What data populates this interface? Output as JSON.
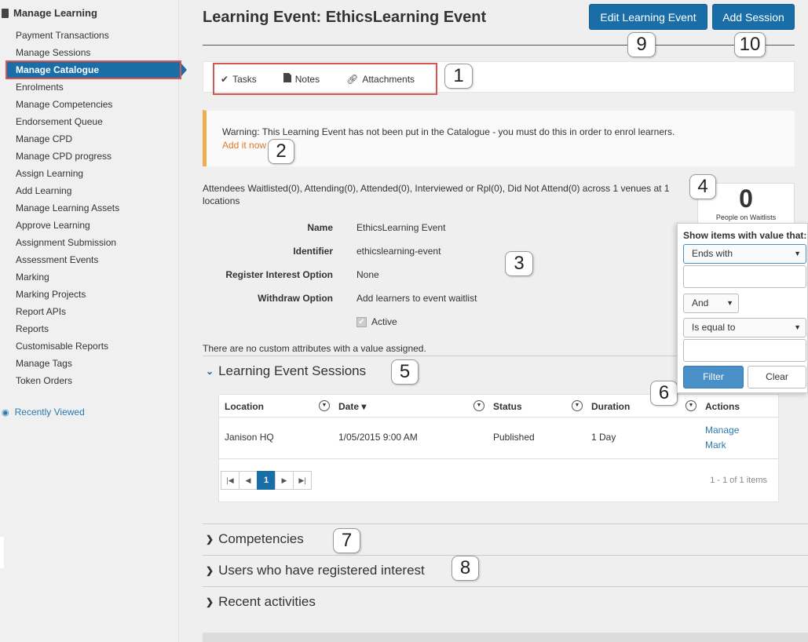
{
  "sidebar": {
    "header": "Manage Learning",
    "items": [
      "Payment Transactions",
      "Manage Sessions",
      "Manage Catalogue",
      "Enrolments",
      "Manage Competencies",
      "Endorsement Queue",
      "Manage CPD",
      "Manage CPD progress",
      "Assign Learning",
      "Add Learning",
      "Manage Learning Assets",
      "Approve Learning",
      "Assignment Submission",
      "Assessment Events",
      "Marking",
      "Marking Projects",
      "Report APIs",
      "Reports",
      "Customisable Reports",
      "Manage Tags",
      "Token Orders"
    ],
    "active_index": 2,
    "recently_viewed": "Recently Viewed"
  },
  "header": {
    "title": "Learning Event: EthicsLearning Event",
    "edit_button": "Edit Learning Event",
    "add_session_button": "Add Session"
  },
  "tabs": {
    "tasks": "Tasks",
    "notes": "Notes",
    "attachments": "Attachments"
  },
  "warning": {
    "message": "Warning: This Learning Event has not been put in the Catalogue - you must do this in order to enrol learners.",
    "link": "Add it now"
  },
  "attendees_summary": "Attendees Waitlisted(0), Attending(0), Attended(0), Interviewed or Rpl(0), Did Not Attend(0) across 1 venues at 1 locations",
  "waitlist": {
    "count": "0",
    "label": "People on Waitlists"
  },
  "details": {
    "name_label": "Name",
    "name_value": "EthicsLearning Event",
    "identifier_label": "Identifier",
    "identifier_value": "ethicslearning-event",
    "register_label": "Register Interest Option",
    "register_value": "None",
    "withdraw_label": "Withdraw Option",
    "withdraw_value": "Add learners to event waitlist",
    "active_label": "Active",
    "active_checked": true
  },
  "no_custom_attrs": "There are no custom attributes with a value assigned.",
  "sessions": {
    "title": "Learning Event Sessions",
    "columns": [
      "Location",
      "Date ▾",
      "Status",
      "Duration",
      "Actions"
    ],
    "rows": [
      {
        "location": "Janison HQ",
        "date": "1/05/2015 9:00 AM",
        "status": "Published",
        "duration": "1 Day",
        "actions": [
          "Manage",
          "Mark"
        ]
      }
    ],
    "pager": {
      "current_page": "1",
      "info": "1 - 1 of 1 items"
    }
  },
  "filter_popup": {
    "title": "Show items with value that:",
    "operator1": "Ends with",
    "logic": "And",
    "operator2": "Is equal to",
    "filter_button": "Filter",
    "clear_button": "Clear"
  },
  "sections": {
    "competencies": "Competencies",
    "registered_interest": "Users who have registered interest",
    "recent_activities": "Recent activities"
  },
  "callouts": [
    "1",
    "2",
    "3",
    "4",
    "5",
    "6",
    "7",
    "8",
    "9",
    "10"
  ],
  "colors": {
    "primary": "#1a6ea8",
    "highlight_border": "#d9534f",
    "warning_accent": "#f0ad4e",
    "link": "#2a7ab0"
  }
}
